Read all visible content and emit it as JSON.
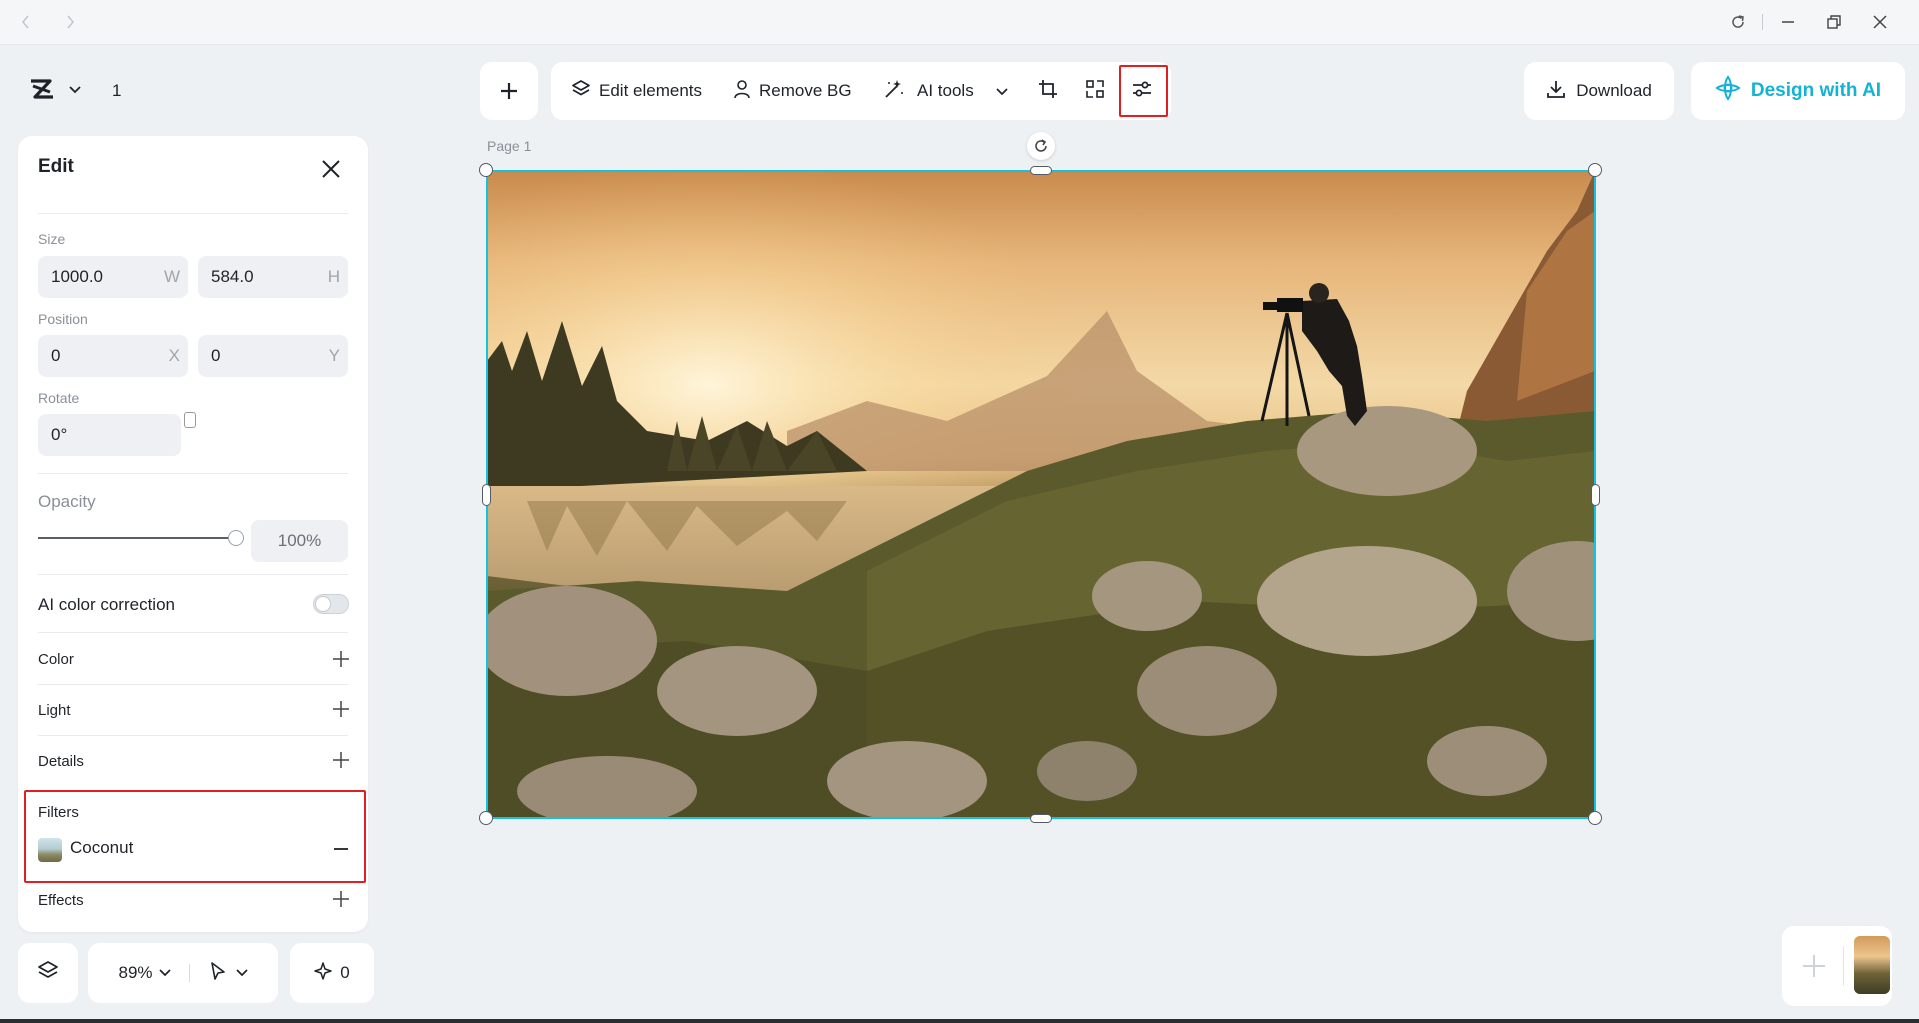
{
  "titlebar": {
    "back_icon": "chevron-left-icon",
    "forward_icon": "chevron-right-icon"
  },
  "header": {
    "page_count": "1"
  },
  "toolbar": {
    "edit_elements": "Edit elements",
    "remove_bg": "Remove BG",
    "ai_tools": "AI tools"
  },
  "actions": {
    "download": "Download",
    "design_ai": "Design with AI"
  },
  "canvas": {
    "page_label": "Page 1"
  },
  "panel": {
    "title": "Edit",
    "size_label": "Size",
    "width": "1000.0",
    "width_suffix": "W",
    "height": "584.0",
    "height_suffix": "H",
    "position_label": "Position",
    "x": "0",
    "x_suffix": "X",
    "y": "0",
    "y_suffix": "Y",
    "rotate_label": "Rotate",
    "rotate": "0°",
    "opacity_label": "Opacity",
    "opacity": "100%",
    "opacity_level": 1.0,
    "ai_color_label": "AI color correction",
    "ai_color_enabled": false,
    "color_label": "Color",
    "light_label": "Light",
    "details_label": "Details",
    "filters_label": "Filters",
    "filter_name": "Coconut",
    "effects_label": "Effects"
  },
  "bottom": {
    "zoom": "89%",
    "sparkle_count": "0"
  },
  "colors": {
    "accent": "#13c2e0",
    "ai_text": "#12b3d6",
    "highlight": "#e02020"
  }
}
